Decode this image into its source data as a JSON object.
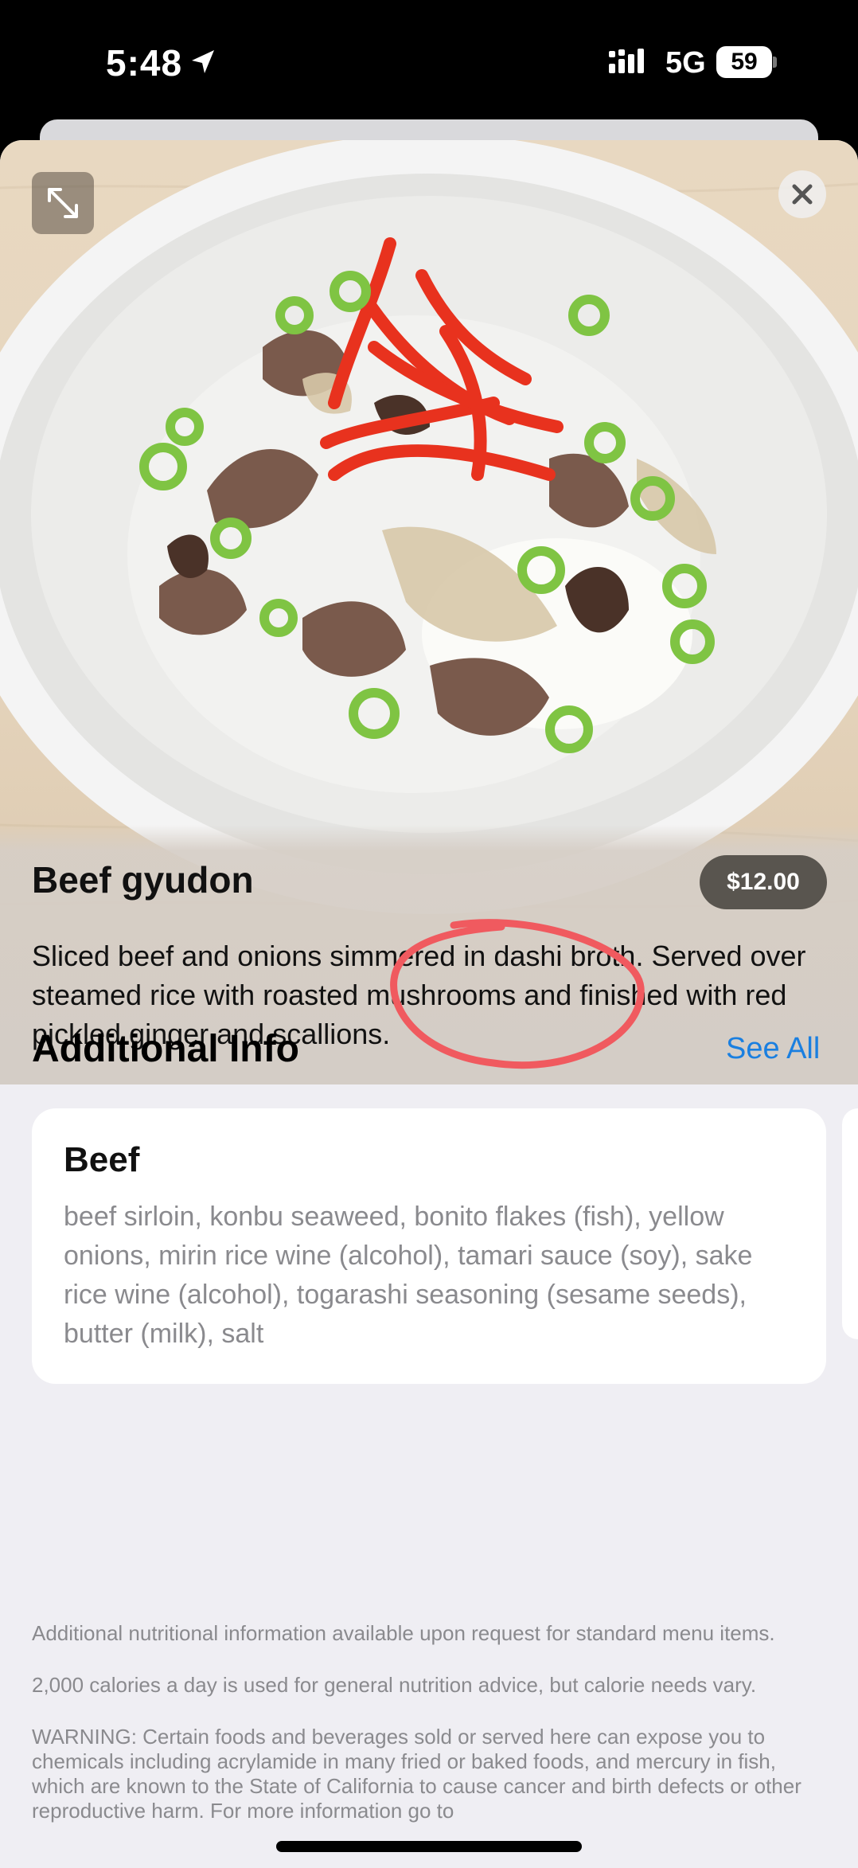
{
  "status_bar": {
    "time": "5:48",
    "network": "5G",
    "battery": "59"
  },
  "item": {
    "title": "Beef gyudon",
    "price": "$12.00",
    "description": "Sliced beef and onions simmered in dashi broth. Served over steamed rice with roasted mushrooms and finished with red pickled ginger and scallions."
  },
  "additional_info": {
    "title": "Additional Info",
    "see_all": "See All",
    "card": {
      "title": "Beef",
      "ingredients": "beef sirloin, konbu seaweed, bonito flakes (fish), yellow onions, mirin rice wine (alcohol), tamari sauce (soy), sake rice wine (alcohol), togarashi seasoning (sesame seeds), butter (milk), salt"
    }
  },
  "notes": {
    "nutrition": "Additional nutritional information available upon request for standard menu items.",
    "calories": "2,000 calories a day is used for general nutrition advice, but calorie needs vary.",
    "warning": "WARNING: Certain foods and beverages sold or served here can expose you to chemicals including acrylamide in many fried or baked foods, and mercury in fish, which are known to the State of California to cause cancer and birth defects or other reproductive harm. For more information go to"
  },
  "icons": {
    "location": "location-arrow-icon",
    "signal": "cellular-signal-icon",
    "battery": "battery-icon",
    "expand": "expand-icon",
    "close": "close-icon"
  },
  "colors": {
    "link": "#1a7fe0",
    "price_pill": "#59554f",
    "annotation": "#f05a5f"
  }
}
